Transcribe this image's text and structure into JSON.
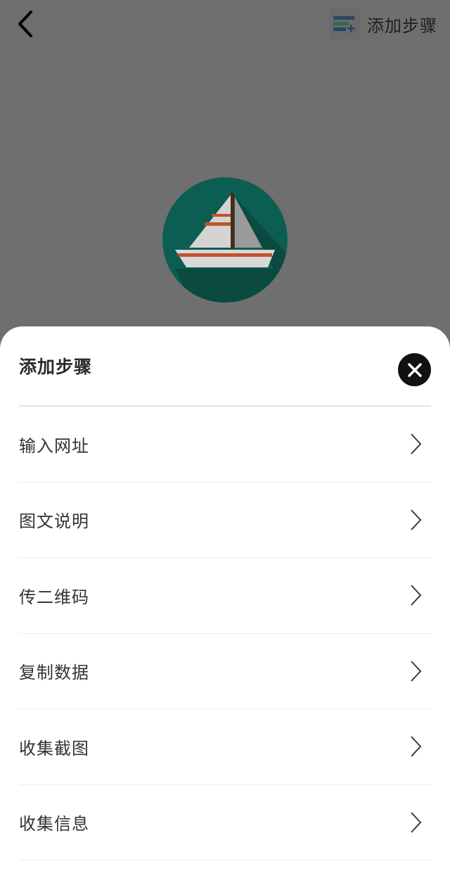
{
  "topbar": {
    "back_icon": "chevron-left-icon",
    "add_step_label": "添加步骤",
    "add_step_icon": "list-add-icon"
  },
  "logo": {
    "icon": "sailboat-icon",
    "colors": {
      "circle": "#0d5e52",
      "shadow": "#0a4a40",
      "sail": "#d8d8d8",
      "stripe": "#c0532a",
      "mast": "#4a2a1a"
    }
  },
  "sheet": {
    "title": "添加步骤",
    "close_icon": "close-icon",
    "items": [
      {
        "label": "输入网址"
      },
      {
        "label": "图文说明"
      },
      {
        "label": "传二维码"
      },
      {
        "label": "复制数据"
      },
      {
        "label": "收集截图"
      },
      {
        "label": "收集信息"
      }
    ]
  },
  "colors": {
    "overlay": "#6f6f6f",
    "sheet_bg": "#ffffff",
    "text": "#333333",
    "divider": "#e4e4e4"
  }
}
